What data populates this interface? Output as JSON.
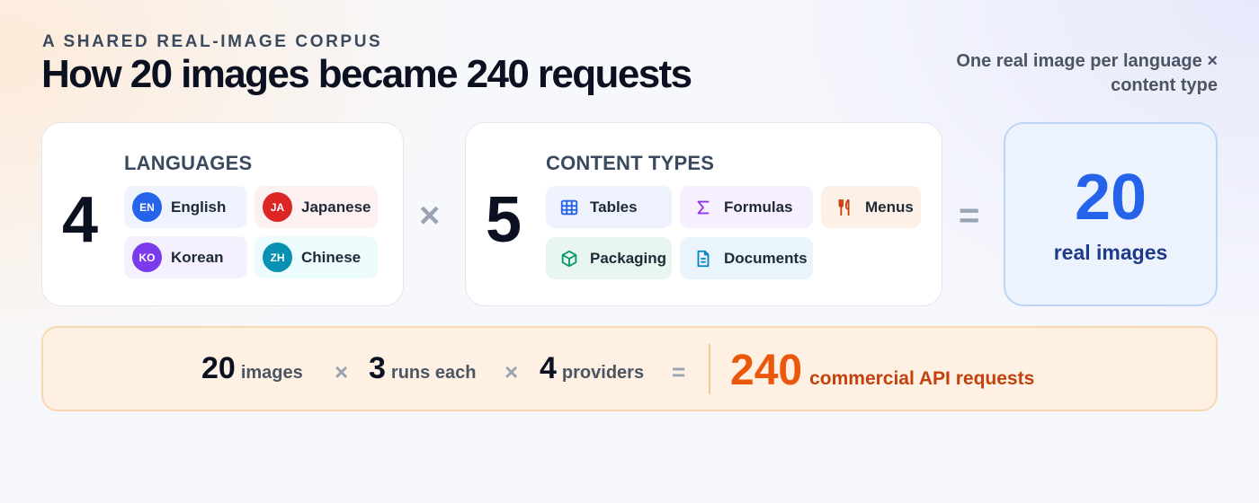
{
  "header": {
    "eyebrow": "A SHARED REAL-IMAGE CORPUS",
    "title": "How 20 images became 240 requests",
    "subtitle": "One real image per language × content type"
  },
  "languages": {
    "count": "4",
    "label": "LANGUAGES",
    "items": [
      {
        "code": "EN",
        "name": "English",
        "color": "#2563eb",
        "bg": "#eef3fe"
      },
      {
        "code": "JA",
        "name": "Japanese",
        "color": "#dc2626",
        "bg": "#fdf0f0"
      },
      {
        "code": "KO",
        "name": "Korean",
        "color": "#7c3aed",
        "bg": "#f4f0fe"
      },
      {
        "code": "ZH",
        "name": "Chinese",
        "color": "#0891b2",
        "bg": "#ecfbfc"
      }
    ]
  },
  "operators": {
    "multiply": "×",
    "equals": "="
  },
  "content_types": {
    "count": "5",
    "label": "CONTENT TYPES",
    "items": [
      {
        "name": "Tables",
        "icon": "table-icon",
        "color": "#2563eb",
        "bg": "#edf2fd"
      },
      {
        "name": "Formulas",
        "icon": "sigma-icon",
        "color": "#9333ea",
        "bg": "#f6effd"
      },
      {
        "name": "Menus",
        "icon": "utensils-icon",
        "color": "#c2410c",
        "bg": "#fdf0e6"
      },
      {
        "name": "Packaging",
        "icon": "box-icon",
        "color": "#059669",
        "bg": "#e9f6f0"
      },
      {
        "name": "Documents",
        "icon": "document-icon",
        "color": "#0284c7",
        "bg": "#eaf4fb"
      }
    ]
  },
  "result": {
    "number": "20",
    "label": "real images"
  },
  "equation": {
    "terms": [
      {
        "value": "20",
        "word": "images"
      },
      {
        "value": "3",
        "word": "runs each"
      },
      {
        "value": "4",
        "word": "providers"
      }
    ],
    "total": {
      "value": "240",
      "word": "commercial API requests"
    }
  }
}
